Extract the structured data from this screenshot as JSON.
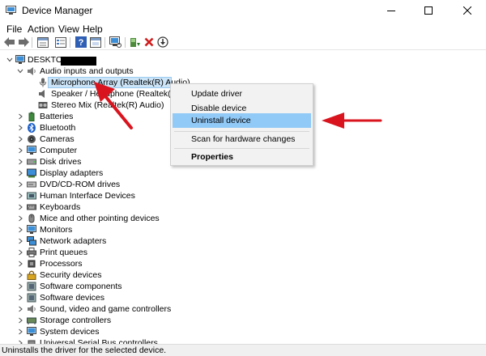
{
  "window": {
    "title": "Device Manager",
    "buttons": [
      "minimize",
      "maximize",
      "close"
    ]
  },
  "menu": [
    "File",
    "Action",
    "View",
    "Help"
  ],
  "toolbar": {
    "icons": [
      "back-icon",
      "forward-icon",
      "properties-sheet-icon",
      "list-icon",
      "help-icon",
      "device-view-icon",
      "scan-hardware-icon",
      "update-driver-icon",
      "uninstall-icon",
      "download-icon"
    ]
  },
  "tree": {
    "root": "DESKTOP-",
    "expanded_category": "Audio inputs and outputs",
    "devices": [
      "Microphone Array (Realtek(R) Audio)",
      "Speaker / Headphone (Realtek(R) Audio)",
      "Stereo Mix (Realtek(R) Audio)"
    ],
    "categories": [
      "Batteries",
      "Bluetooth",
      "Cameras",
      "Computer",
      "Disk drives",
      "Display adapters",
      "DVD/CD-ROM drives",
      "Human Interface Devices",
      "Keyboards",
      "Mice and other pointing devices",
      "Monitors",
      "Network adapters",
      "Print queues",
      "Processors",
      "Security devices",
      "Software components",
      "Software devices",
      "Sound, video and game controllers",
      "Storage controllers",
      "System devices",
      "Universal Serial Bus controllers"
    ]
  },
  "context_menu": {
    "items": [
      {
        "label": "Update driver"
      },
      {
        "label": "Disable device"
      },
      {
        "label": "Uninstall device",
        "highlighted": true
      },
      {
        "label": "Scan for hardware changes"
      },
      {
        "label": "Properties",
        "bold": true
      }
    ]
  },
  "status": "Uninstalls the driver for the selected device.",
  "colors": {
    "selection": "#cce4f7",
    "menu_highlight": "#91c9f7",
    "annotation_arrow": "#d9141e"
  }
}
